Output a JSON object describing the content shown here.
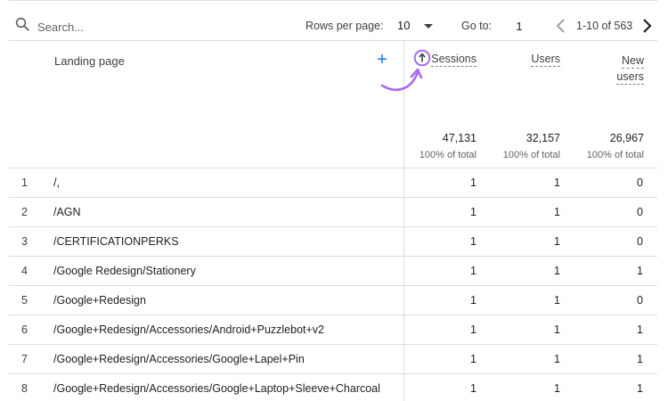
{
  "toolbar": {
    "search_placeholder": "Search...",
    "rows_per_page_label": "Rows per page:",
    "rows_per_page_value": "10",
    "goto_label": "Go to:",
    "goto_value": "1",
    "range_text": "1-10 of 563",
    "icons": [
      "search-icon",
      "chevron-left-icon",
      "chevron-right-icon",
      "caret-down-icon"
    ]
  },
  "table": {
    "dimension_header": "Landing page",
    "add_symbol": "+",
    "metric_headers": {
      "sessions": "Sessions",
      "users": "Users",
      "new_users_line1": "New",
      "new_users_line2": "users"
    },
    "totals": {
      "sessions": "47,131",
      "sessions_sub": "100% of total",
      "users": "32,157",
      "users_sub": "100% of total",
      "new_users": "26,967",
      "new_users_sub": "100% of total"
    },
    "rows": [
      {
        "index": "1",
        "page": "/,",
        "sessions": "1",
        "users": "1",
        "new_users": "0"
      },
      {
        "index": "2",
        "page": "/AGN",
        "sessions": "1",
        "users": "1",
        "new_users": "0"
      },
      {
        "index": "3",
        "page": "/CERTIFICATIONPERKS",
        "sessions": "1",
        "users": "1",
        "new_users": "0"
      },
      {
        "index": "4",
        "page": "/Google Redesign/Stationery",
        "sessions": "1",
        "users": "1",
        "new_users": "1"
      },
      {
        "index": "5",
        "page": "/Google+Redesign",
        "sessions": "1",
        "users": "1",
        "new_users": "0"
      },
      {
        "index": "6",
        "page": "/Google+Redesign/Accessories/Android+Puzzlebot+v2",
        "sessions": "1",
        "users": "1",
        "new_users": "1"
      },
      {
        "index": "7",
        "page": "/Google+Redesign/Accessories/Google+Lapel+Pin",
        "sessions": "1",
        "users": "1",
        "new_users": "1"
      },
      {
        "index": "8",
        "page": "/Google+Redesign/Accessories/Google+Laptop+Sleeve+Charcoal",
        "sessions": "1",
        "users": "1",
        "new_users": "1"
      }
    ]
  },
  "colors": {
    "accent_blue": "#1a73e8",
    "annotation_purple": "#a66df0",
    "divider": "#dadce0"
  }
}
